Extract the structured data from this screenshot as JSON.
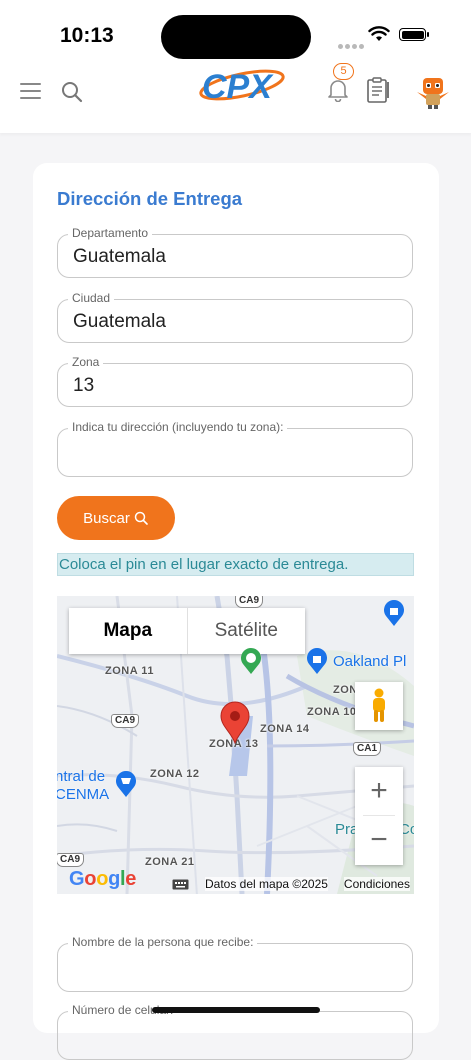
{
  "status_bar": {
    "time": "10:13"
  },
  "header": {
    "logo_text": "CPX",
    "notifications_count": "5"
  },
  "form": {
    "title": "Dirección de Entrega",
    "departamento": {
      "label": "Departamento",
      "value": "Guatemala"
    },
    "ciudad": {
      "label": "Ciudad",
      "value": "Guatemala"
    },
    "zona": {
      "label": "Zona",
      "value": "13"
    },
    "direccion": {
      "label": "Indica tu dirección (incluyendo tu zona):",
      "value": ""
    },
    "buscar_label": "Buscar",
    "pin_hint": "Coloca el pin en el lugar exacto de entrega.",
    "nombre": {
      "label": "Nombre de la persona que recibe:",
      "value": ""
    },
    "celular": {
      "label": "Número de celular:",
      "value": ""
    }
  },
  "map": {
    "type_map": "Mapa",
    "type_satellite": "Satélite",
    "zoom_in": "+",
    "zoom_out": "−",
    "google": "Google",
    "map_data": "Datos del mapa ©2025",
    "terms": "Condiciones",
    "labels": {
      "zona11": "ZONA 11",
      "zona13": "ZONA 13",
      "zona14": "ZONA 14",
      "zona10": "ZONA 10",
      "zona12": "ZONA 12",
      "zona21": "ZONA 21",
      "zon": "ZON",
      "ca9_top": "CA9",
      "ca9_mid": "CA9",
      "ca9_bot": "CA9",
      "ca1": "CA1",
      "oakland": "Oakland Pl",
      "central1": "ntral de",
      "central2": "CENMA",
      "pra": "Pra",
      "co": "Co"
    }
  }
}
